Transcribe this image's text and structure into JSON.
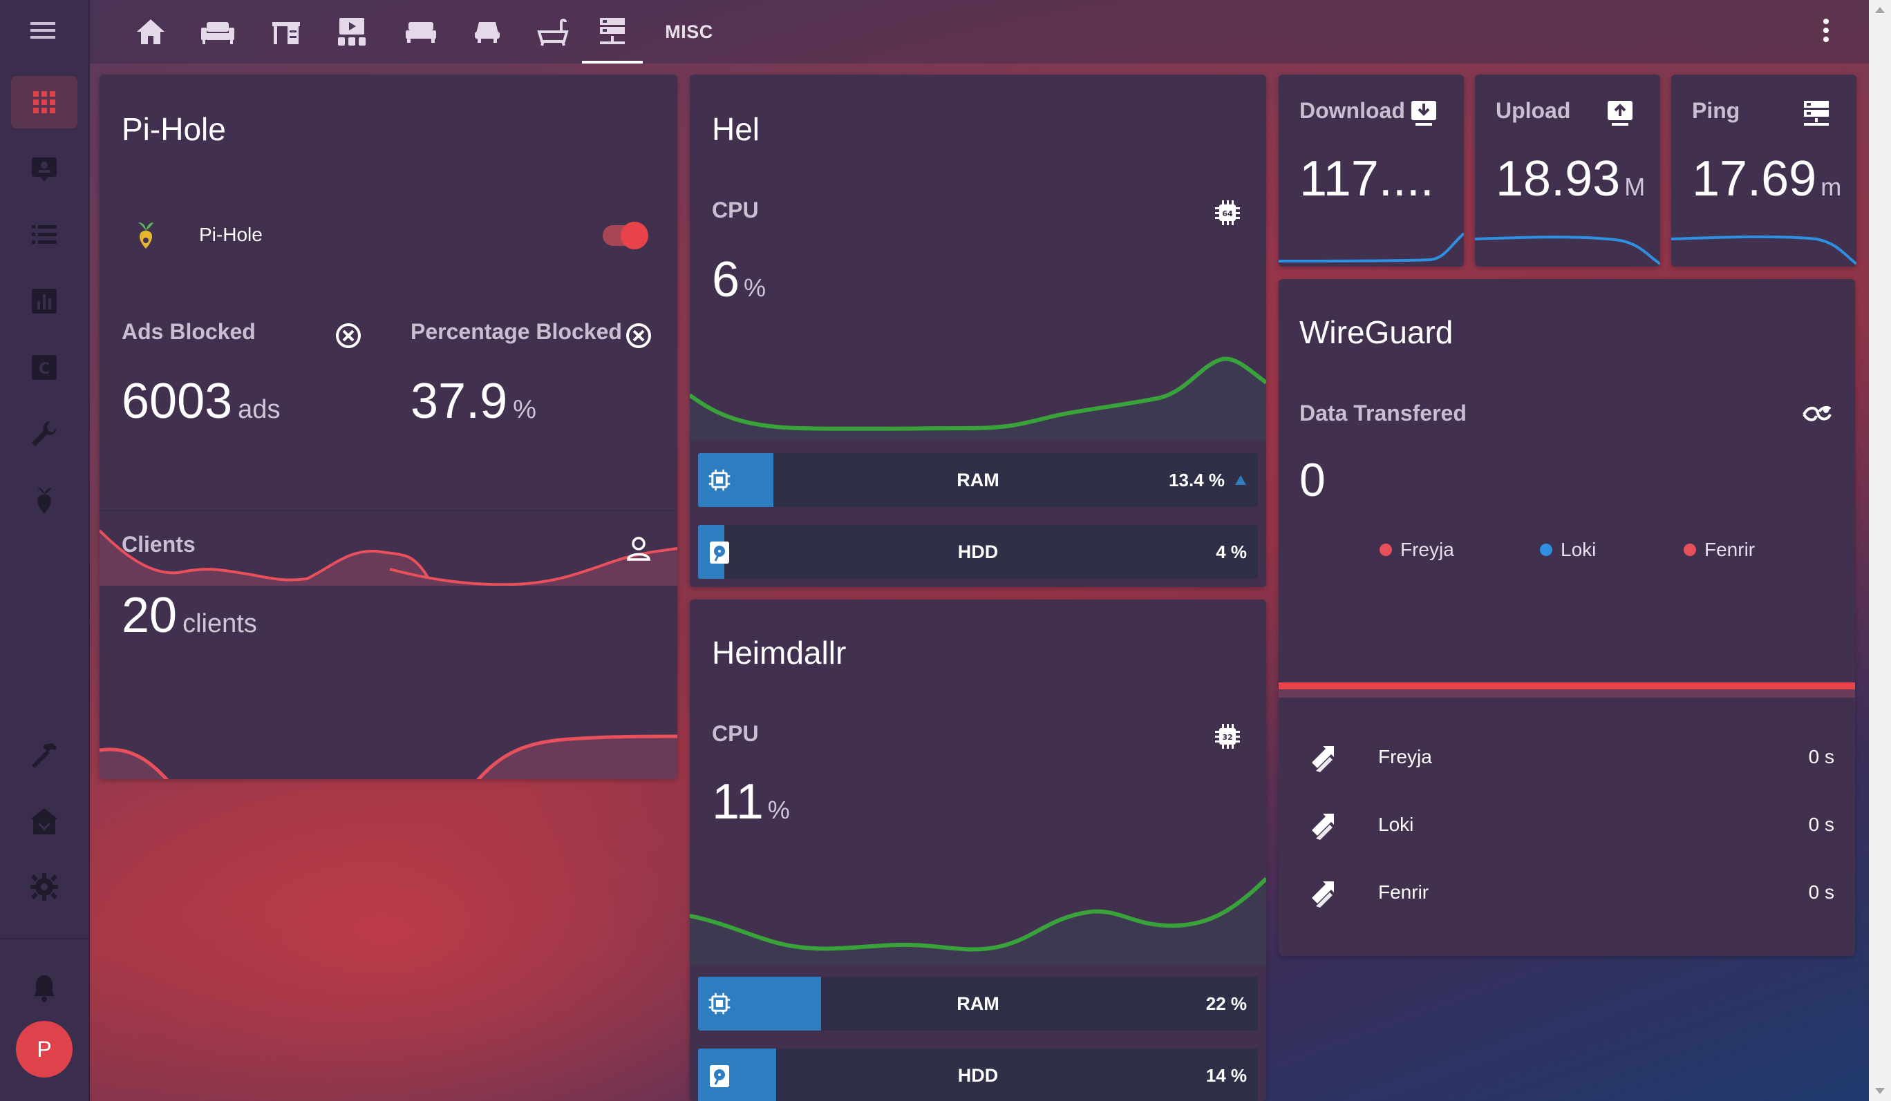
{
  "header": {
    "tabs": [
      {
        "icon": "home-icon"
      },
      {
        "icon": "sofa-icon"
      },
      {
        "icon": "desk-icon"
      },
      {
        "icon": "theater-icon"
      },
      {
        "icon": "bed-icon"
      },
      {
        "icon": "car-seat-icon"
      },
      {
        "icon": "bathtub-icon"
      },
      {
        "icon": "server-icon",
        "active": true
      },
      {
        "label": "MISC"
      }
    ]
  },
  "sidebar": {
    "items": [
      "apps-grid-icon",
      "contact-card-icon",
      "list-icon",
      "chart-box-icon",
      "calendar-c-icon",
      "wrench-icon",
      "pi-hole-icon",
      "hammer-icon",
      "hacs-icon",
      "settings-icon",
      "bell-icon"
    ],
    "avatar_letter": "P"
  },
  "pihole": {
    "title": "Pi-Hole",
    "switch_label": "Pi-Hole",
    "switch_on": true,
    "ads_blocked_label": "Ads Blocked",
    "ads_blocked_value": "6003",
    "ads_blocked_unit": "ads",
    "pct_blocked_label": "Percentage Blocked",
    "pct_blocked_value": "37.9",
    "pct_blocked_unit": "%",
    "clients_label": "Clients",
    "clients_value": "20",
    "clients_unit": "clients"
  },
  "hel": {
    "title": "Hel",
    "cpu_label": "CPU",
    "cpu_value": "6",
    "cpu_unit": "%",
    "ram_label": "RAM",
    "ram_value": "13.4 %",
    "ram_fraction": 0.134,
    "hdd_label": "HDD",
    "hdd_value": "4 %",
    "hdd_fraction": 0.04
  },
  "heimdallr": {
    "title": "Heimdallr",
    "cpu_label": "CPU",
    "cpu_value": "11",
    "cpu_unit": "%",
    "ram_label": "RAM",
    "ram_value": "22 %",
    "ram_fraction": 0.22,
    "hdd_label": "HDD",
    "hdd_value": "14 %",
    "hdd_fraction": 0.14
  },
  "speedtest": {
    "download_label": "Download",
    "download_value": "117....",
    "upload_label": "Upload",
    "upload_value": "18.93",
    "upload_unit": "M",
    "ping_label": "Ping",
    "ping_value": "17.69",
    "ping_unit": "m"
  },
  "wireguard": {
    "title": "WireGuard",
    "data_label": "Data Transfered",
    "data_value": "0",
    "legend": [
      {
        "name": "Freyja",
        "color": "#e8505b"
      },
      {
        "name": "Loki",
        "color": "#2f8fe0"
      },
      {
        "name": "Fenrir",
        "color": "#e8505b"
      }
    ],
    "peers": [
      {
        "name": "Freyja",
        "value": "0 s"
      },
      {
        "name": "Loki",
        "value": "0 s"
      },
      {
        "name": "Fenrir",
        "value": "0 s"
      }
    ]
  },
  "colors": {
    "accent_red": "#e8505b",
    "cpu_green": "#3aa23a",
    "bar_blue": "#2e7dc0",
    "card_bg": "#42304f"
  }
}
